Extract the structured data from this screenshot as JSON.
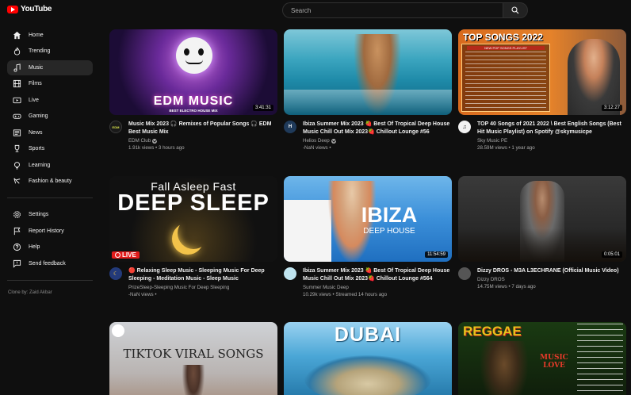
{
  "header": {
    "logo_text": "YouTube",
    "search_placeholder": "Search",
    "brand_color": "#ff0000"
  },
  "sidebar": {
    "items": [
      {
        "label": "Home",
        "icon": "home-icon"
      },
      {
        "label": "Trending",
        "icon": "fire-icon"
      },
      {
        "label": "Music",
        "icon": "music-note-icon",
        "active": true
      },
      {
        "label": "Films",
        "icon": "film-icon"
      },
      {
        "label": "Live",
        "icon": "live-icon"
      },
      {
        "label": "Gaming",
        "icon": "gamepad-icon"
      },
      {
        "label": "News",
        "icon": "newspaper-icon"
      },
      {
        "label": "Sports",
        "icon": "trophy-icon"
      },
      {
        "label": "Learning",
        "icon": "lightbulb-icon"
      },
      {
        "label": "Fashion & beauty",
        "icon": "hanger-icon"
      }
    ],
    "secondary": [
      {
        "label": "Settings",
        "icon": "gear-icon"
      },
      {
        "label": "Report History",
        "icon": "flag-icon"
      },
      {
        "label": "Help",
        "icon": "help-icon"
      },
      {
        "label": "Send feedback",
        "icon": "feedback-icon"
      }
    ],
    "clone_by": "Clone by: Zaid Akbar"
  },
  "thumb_text": {
    "edm_title": "EDM MUSIC",
    "edm_sub": "BEST ELECTRO HOUSE MIX",
    "top_songs": "TOP SONGS 2022",
    "top_songs_sub": "NEW POP SONGS PLAYLIST",
    "sleep_line1": "Fall Asleep Fast",
    "sleep_line2": "DEEP SLEEP",
    "ibiza": "IBIZA",
    "ibiza_sub": "DEEP HOUSE",
    "tiktok": "TIKTOK VIRAL SONGS",
    "dubai": "DUBAI",
    "reggae": "REGGAE",
    "reggae_sub": "MUSIC LOVE"
  },
  "videos": [
    {
      "title": "Music Mix 2023 🎧 Remixes of Popular Songs 🎧 EDM Best Music Mix",
      "channel": "EDM Club",
      "verified": true,
      "stats": "1.91k views • 3 hours ago",
      "duration": "3:41:31"
    },
    {
      "title": "Ibiza Summer Mix 2023 🍓 Best Of Tropical Deep House Music Chill Out Mix 2023🍓 Chillout Lounge #56",
      "channel": "Helios Deep",
      "verified": true,
      "stats": "-NaN views •",
      "duration": ""
    },
    {
      "title": "TOP 40 Songs of 2021 2022 \\ Best English Songs (Best Hit Music Playlist) on Spotify @skymusicpe",
      "channel": "Sky Music PE",
      "verified": false,
      "stats": "28.59M views • 1 year ago",
      "duration": "3:12:27"
    },
    {
      "title": "🔴 Relaxing Sleep Music - Sleeping Music For Deep Sleeping - Meditation Music - Sleep Music",
      "channel": "PrizeSleep-Sleeping Music For Deep Sleeping",
      "verified": false,
      "stats": "-NaN views •",
      "duration": "",
      "live": "LIVE"
    },
    {
      "title": "Ibiza Summer Mix 2023 🍓 Best Of Tropical Deep House Music Chill Out Mix 2023🍓 Chillout Lounge #564",
      "channel": "Summer Music Deep",
      "verified": false,
      "stats": "10.29k views • Streamed 14 hours ago",
      "duration": "11:54:59"
    },
    {
      "title": "Dizzy DROS - M3A L3ECHRANE (Official Music Video)",
      "channel": "Dizzy DROS",
      "verified": false,
      "stats": "14.75M views • 7 days ago",
      "duration": "0:05:01"
    }
  ]
}
